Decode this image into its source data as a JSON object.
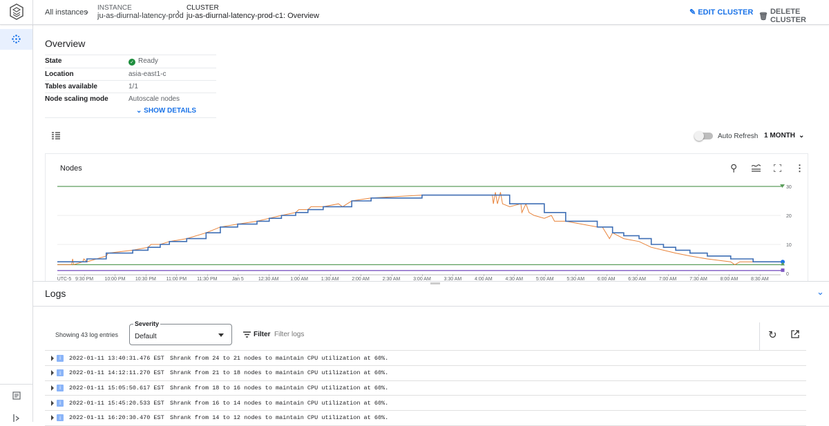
{
  "header": {
    "breadcrumb": [
      {
        "label": "All instances"
      },
      {
        "caption": "INSTANCE",
        "label": "ju-as-diurnal-latency-prod"
      },
      {
        "caption": "CLUSTER",
        "label": "ju-as-diurnal-latency-prod-c1: Overview"
      }
    ],
    "edit_label": "EDIT CLUSTER",
    "delete_label": "DELETE CLUSTER"
  },
  "overview": {
    "title": "Overview",
    "rows": [
      {
        "label": "State",
        "value": "Ready"
      },
      {
        "label": "Location",
        "value": "asia-east1-c"
      },
      {
        "label": "Tables available",
        "value": "1/1"
      },
      {
        "label": "Node scaling mode",
        "value": "Autoscale nodes"
      }
    ],
    "show_details": "SHOW DETAILS",
    "state_color": "#1e8e3e"
  },
  "toolbar": {
    "auto_refresh_label": "Auto Refresh",
    "auto_refresh_on": false,
    "range": "1 MONTH"
  },
  "chart_data": {
    "type": "line",
    "title": "Nodes",
    "x_type": "time",
    "xlim": [
      "21:00",
      "08:50"
    ],
    "x_ticks": [
      "UTC-5",
      "9:30 PM",
      "10:00 PM",
      "10:30 PM",
      "11:00 PM",
      "11:30 PM",
      "Jan 5",
      "12:30 AM",
      "1:00 AM",
      "1:30 AM",
      "2:00 AM",
      "2:30 AM",
      "3:00 AM",
      "3:30 AM",
      "4:00 AM",
      "4:30 AM",
      "5:00 AM",
      "5:30 AM",
      "6:00 AM",
      "6:30 AM",
      "7:00 AM",
      "7:30 AM",
      "8:00 AM",
      "8:30 AM"
    ],
    "y_ticks": [
      0,
      10,
      20,
      30
    ],
    "ylim": [
      0,
      30
    ],
    "grid": true,
    "reference_lines": [
      {
        "value": 30,
        "color": "#5c9e5c"
      },
      {
        "value": 3,
        "color": "#5c9e5c"
      },
      {
        "value": 1,
        "color": "#7e57c2"
      }
    ],
    "series": [
      {
        "color": "#3f6fb5",
        "step": true,
        "points": [
          [
            "21:00",
            4
          ],
          [
            "21:29",
            5
          ],
          [
            "21:48",
            7
          ],
          [
            "22:14",
            8
          ],
          [
            "22:29",
            9
          ],
          [
            "22:41",
            10
          ],
          [
            "22:50",
            11
          ],
          [
            "23:07",
            12
          ],
          [
            "23:26",
            14
          ],
          [
            "23:40",
            16
          ],
          [
            "23:57",
            17
          ],
          [
            "00:16",
            18
          ],
          [
            "00:28",
            19
          ],
          [
            "00:40",
            20
          ],
          [
            "00:54",
            21
          ],
          [
            "01:06",
            22
          ],
          [
            "01:21",
            23
          ],
          [
            "01:49",
            25
          ],
          [
            "02:08",
            26
          ],
          [
            "02:58",
            27
          ],
          [
            "04:24",
            24
          ],
          [
            "04:58",
            21
          ],
          [
            "05:19",
            18
          ],
          [
            "05:50",
            16
          ],
          [
            "06:05",
            14
          ],
          [
            "06:16",
            13
          ],
          [
            "06:31",
            12
          ],
          [
            "06:43",
            10
          ],
          [
            "06:55",
            9
          ],
          [
            "07:07",
            8
          ],
          [
            "07:21",
            7
          ],
          [
            "07:38",
            6
          ],
          [
            "08:01",
            5
          ],
          [
            "08:23",
            4
          ],
          [
            "08:50",
            4
          ]
        ]
      },
      {
        "color": "#e8833a",
        "step": false,
        "points": [
          [
            "21:00",
            3
          ],
          [
            "21:14",
            3
          ],
          [
            "21:15",
            5
          ],
          [
            "21:16",
            3
          ],
          [
            "21:25",
            4
          ],
          [
            "21:26",
            5
          ],
          [
            "21:29",
            4
          ],
          [
            "21:48",
            6
          ],
          [
            "21:50",
            7
          ],
          [
            "22:14",
            8
          ],
          [
            "22:29",
            9
          ],
          [
            "22:32",
            10
          ],
          [
            "22:41",
            10
          ],
          [
            "22:50",
            11
          ],
          [
            "23:07",
            12
          ],
          [
            "23:26",
            14
          ],
          [
            "23:40",
            16
          ],
          [
            "23:57",
            17
          ],
          [
            "00:16",
            18
          ],
          [
            "00:28",
            19
          ],
          [
            "00:40",
            20
          ],
          [
            "00:54",
            21
          ],
          [
            "00:57",
            22
          ],
          [
            "01:06",
            22
          ],
          [
            "01:09",
            23
          ],
          [
            "01:21",
            23
          ],
          [
            "01:36",
            24
          ],
          [
            "01:40",
            23
          ],
          [
            "01:49",
            25
          ],
          [
            "02:08",
            26
          ],
          [
            "02:58",
            27
          ],
          [
            "04:07",
            27
          ],
          [
            "04:08",
            24
          ],
          [
            "04:10",
            28
          ],
          [
            "04:12",
            24
          ],
          [
            "04:15",
            28
          ],
          [
            "04:17",
            24
          ],
          [
            "04:24",
            23
          ],
          [
            "04:35",
            24
          ],
          [
            "04:36",
            21
          ],
          [
            "04:40",
            24
          ],
          [
            "04:43",
            21
          ],
          [
            "04:48",
            20
          ],
          [
            "04:58",
            19
          ],
          [
            "05:05",
            20
          ],
          [
            "05:08",
            18
          ],
          [
            "05:19",
            18
          ],
          [
            "05:50",
            16
          ],
          [
            "05:55",
            16
          ],
          [
            "06:02",
            12
          ],
          [
            "06:05",
            14
          ],
          [
            "06:16",
            12
          ],
          [
            "06:31",
            11
          ],
          [
            "06:43",
            9
          ],
          [
            "06:55",
            8
          ],
          [
            "07:07",
            7
          ],
          [
            "07:21",
            6
          ],
          [
            "07:38",
            5
          ],
          [
            "08:01",
            4
          ],
          [
            "08:05",
            3
          ],
          [
            "08:10",
            4
          ],
          [
            "08:23",
            4
          ],
          [
            "08:50",
            4
          ]
        ]
      }
    ],
    "end_markers": [
      {
        "value": 4,
        "color": "#1a73e8"
      },
      {
        "value": 3,
        "color": "#5c9e5c"
      },
      {
        "value": 1,
        "color": "#7e57c2"
      }
    ]
  },
  "logs": {
    "title": "Logs",
    "count_text": "Showing 43 log entries",
    "severity_label": "Severity",
    "severity_value": "Default",
    "filter_label": "Filter",
    "filter_placeholder": "Filter logs",
    "entries": [
      {
        "severity": "i",
        "timestamp": "2022-01-11 13:40:31.476 EST",
        "message": "Shrank from 24 to 21 nodes to maintain CPU utilization at 60%."
      },
      {
        "severity": "i",
        "timestamp": "2022-01-11 14:12:11.270 EST",
        "message": "Shrank from 21 to 18 nodes to maintain CPU utilization at 60%."
      },
      {
        "severity": "i",
        "timestamp": "2022-01-11 15:05:50.617 EST",
        "message": "Shrank from 18 to 16 nodes to maintain CPU utilization at 60%."
      },
      {
        "severity": "i",
        "timestamp": "2022-01-11 15:45:20.533 EST",
        "message": "Shrank from 16 to 14 nodes to maintain CPU utilization at 60%."
      },
      {
        "severity": "i",
        "timestamp": "2022-01-11 16:20:30.470 EST",
        "message": "Shrank from 14 to 12 nodes to maintain CPU utilization at 60%."
      }
    ]
  }
}
